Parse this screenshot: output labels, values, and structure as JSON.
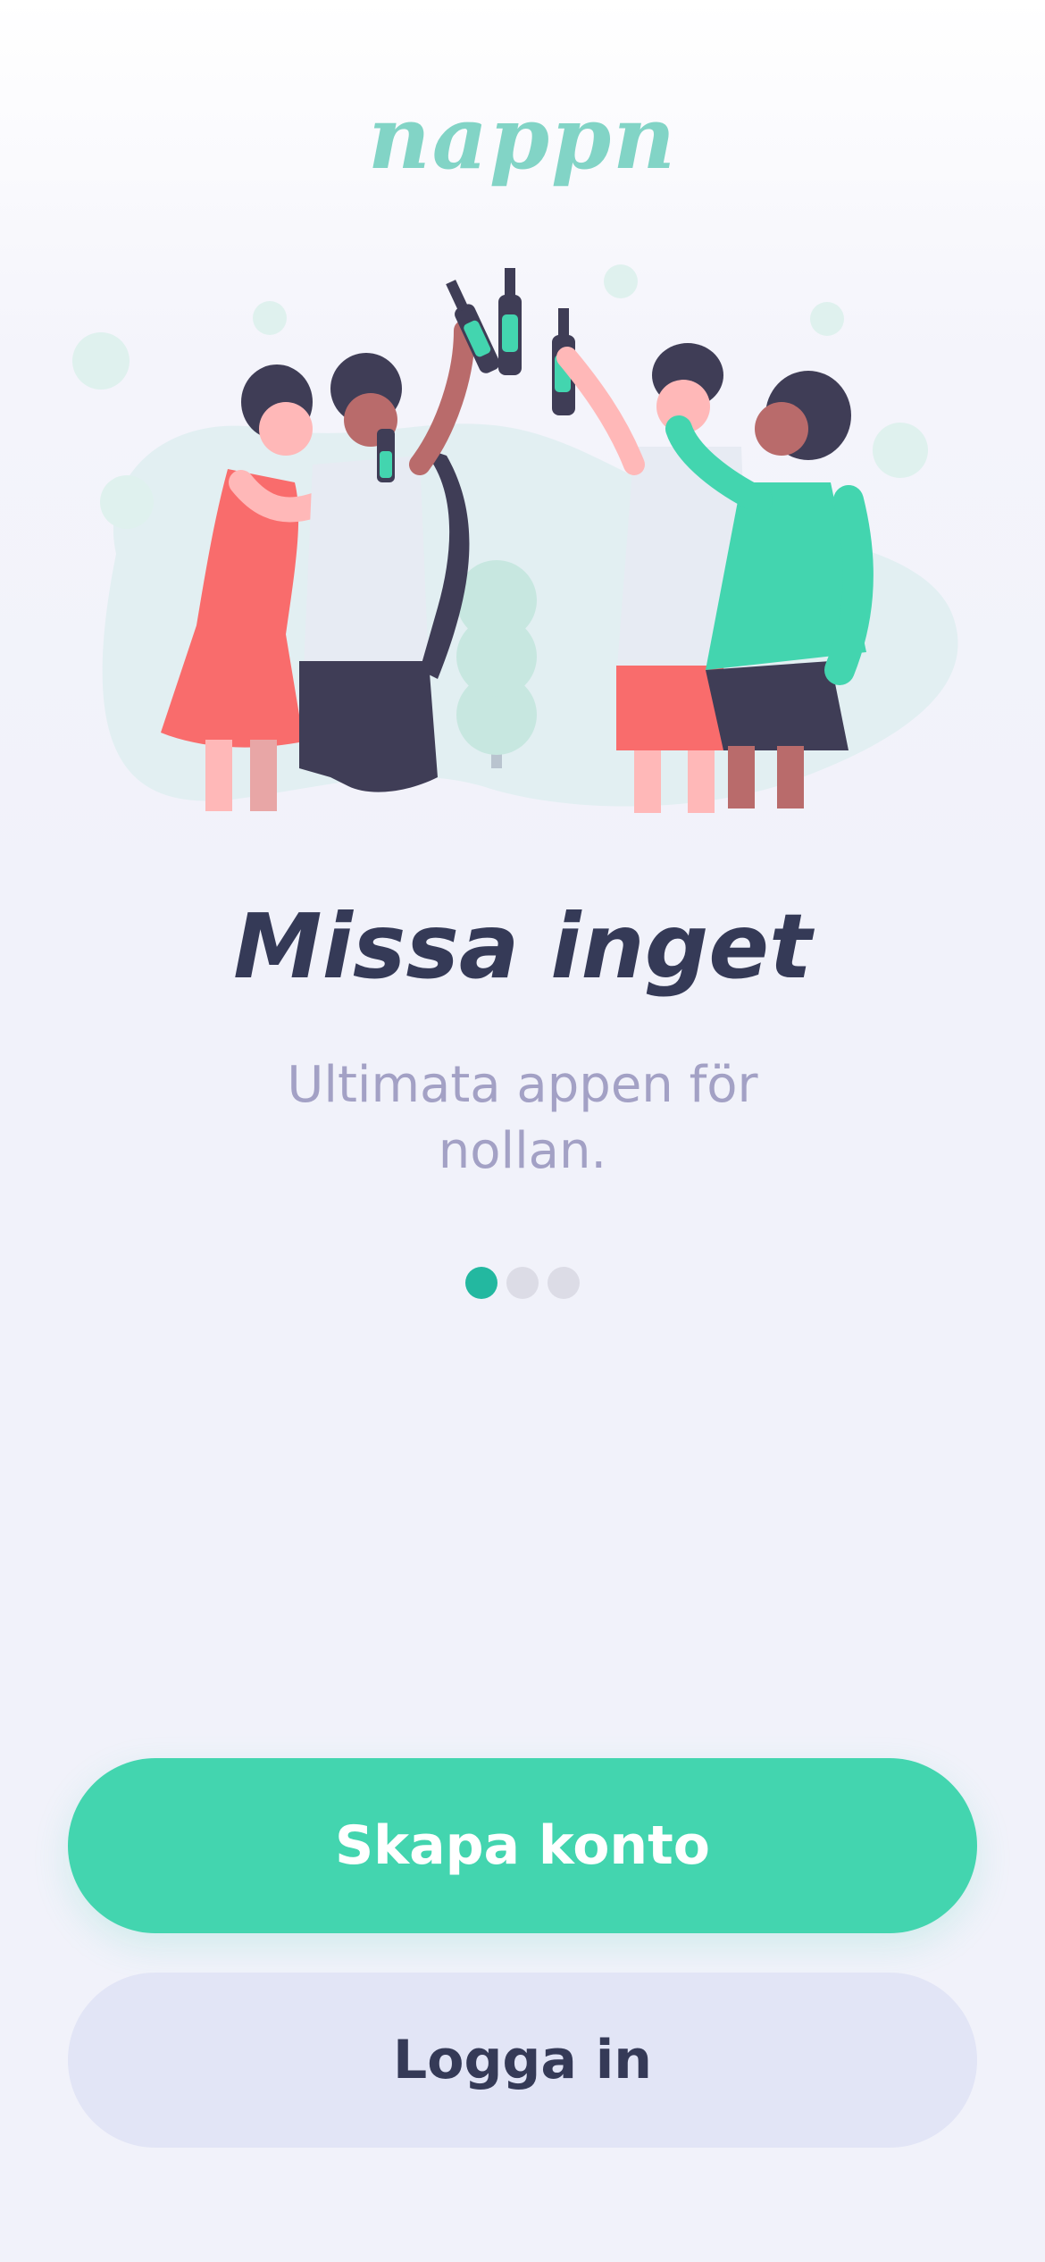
{
  "app": {
    "logo_text": "nappn",
    "brand_color": "#82d4c6"
  },
  "onboarding": {
    "illustration": "friends-toasting-illustration",
    "title": "Missa inget",
    "subtitle": "Ultimata appen för nollan.",
    "page_indicator": {
      "current": 1,
      "total": 3,
      "active_color": "#23b8a0",
      "inactive_color": "#dcdce6"
    }
  },
  "actions": {
    "create_account_label": "Skapa konto",
    "login_label": "Logga in",
    "primary_color": "#43d5af",
    "secondary_color": "#e2e5f6"
  }
}
